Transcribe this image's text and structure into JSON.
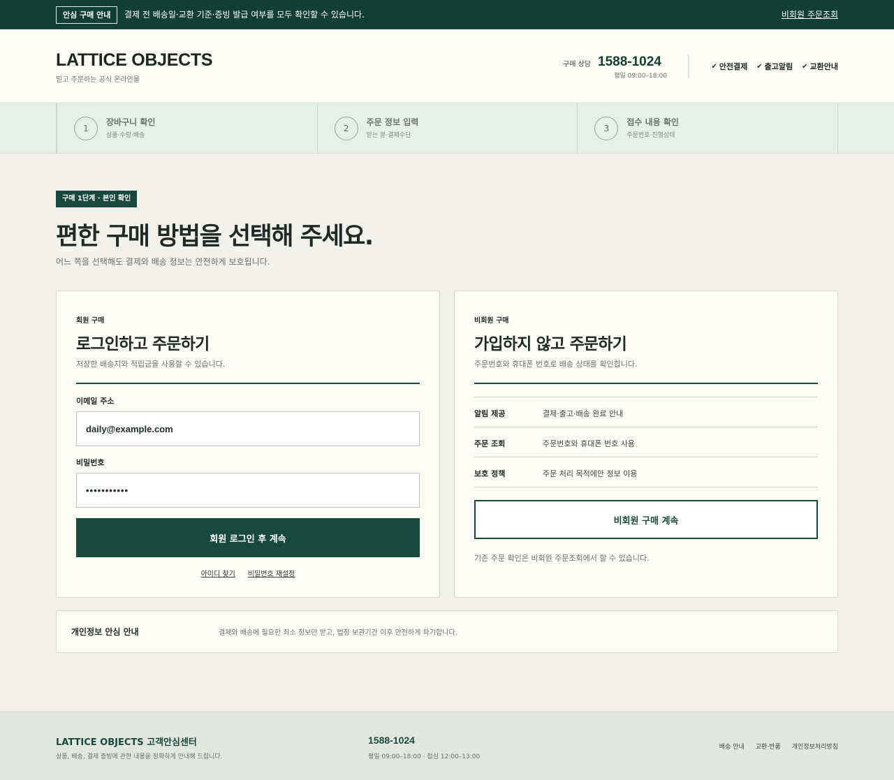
{
  "topbar": {
    "badge": "안심 구매 안내",
    "notice": "결제 전 배송일·교환 기준·증빙 발급 여부를 모두 확인할 수 있습니다.",
    "guest_lookup": "비회원 주문조회"
  },
  "header": {
    "brand": "LATTICE OBJECTS",
    "tagline": "믿고 주문하는 공식 온라인몰",
    "consult_label": "구매 상담",
    "phone": "1588-1024",
    "hours": "평일 09:00–18:00",
    "trust_items": [
      {
        "icon": "check-icon",
        "label": "안전결제"
      },
      {
        "icon": "check-icon",
        "label": "출고알림"
      },
      {
        "icon": "check-icon",
        "label": "교환안내"
      }
    ]
  },
  "steps": [
    {
      "number": "1",
      "title": "장바구니 확인",
      "sub": "상품·수량·배송"
    },
    {
      "number": "2",
      "title": "주문 정보 입력",
      "sub": "받는 분·결제수단"
    },
    {
      "number": "3",
      "title": "접수 내용 확인",
      "sub": "주문번호·진행상태"
    }
  ],
  "hero": {
    "badge": "구매 1단계 · 본인 확인",
    "title": "편한 구매 방법을 선택해 주세요.",
    "subtitle": "어느 쪽을 선택해도 결제와 배송 정보는 안전하게 보호됩니다."
  },
  "member": {
    "kicker": "회원 구매",
    "title": "로그인하고 주문하기",
    "desc": "저장한 배송지와 적립금을 사용할 수 있습니다.",
    "email_label": "이메일 주소",
    "email_value": "daily@example.com",
    "password_label": "비밀번호",
    "password_value": "•••••••••••",
    "submit": "회원 로그인 후 계속",
    "find_id": "아이디 찾기",
    "reset_password": "비밀번호 재설정"
  },
  "guest": {
    "kicker": "비회원 구매",
    "title": "가입하지 않고 주문하기",
    "desc": "주문번호와 휴대폰 번호로 배송 상태를 확인합니다.",
    "rows": [
      {
        "key": "알림 제공",
        "value": "결제·출고·배송 완료 안내"
      },
      {
        "key": "주문 조회",
        "value": "주문번호와 휴대폰 번호 사용"
      },
      {
        "key": "보호 정책",
        "value": "주문 처리 목적에만 정보 이용"
      }
    ],
    "continue": "비회원 구매 계속",
    "note": "기존 주문 확인은 비회원 주문조회에서 할 수 있습니다."
  },
  "privacy": {
    "title": "개인정보 안심 안내",
    "text": "결제와 배송에 필요한 최소 정보만 받고, 법정 보관기간 이후 안전하게 파기합니다."
  },
  "footer": {
    "brand": "LATTICE OBJECTS 고객안심센터",
    "desc": "상품, 배송, 결제 증빙에 관한 내용을 정확하게 안내해 드립니다.",
    "phone": "1588-1024",
    "hours": "평일 09:00–18:00 · 점심 12:00–13:00",
    "links": [
      "배송 안내",
      "교환·반품",
      "개인정보처리방침"
    ]
  },
  "colors": {
    "brand_green": "#123f33",
    "button_green": "#174a3c",
    "page_background": "#f3f1ec",
    "panel_background": "#fdfcf7"
  }
}
